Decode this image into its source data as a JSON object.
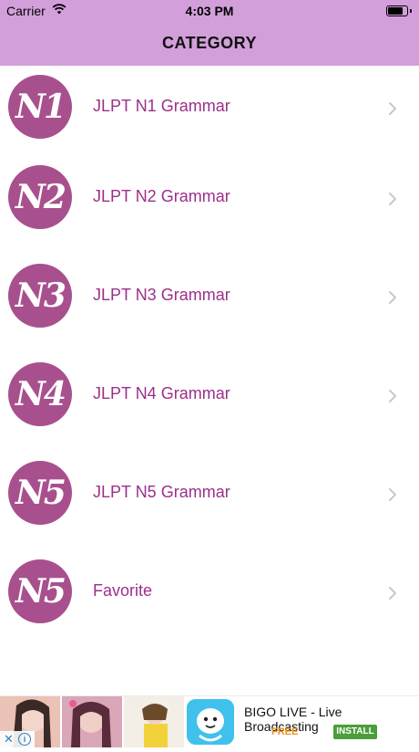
{
  "status_bar": {
    "carrier": "Carrier",
    "time": "4:03 PM",
    "wifi_icon": "wifi-icon",
    "battery_icon": "battery-icon"
  },
  "header": {
    "title": "CATEGORY",
    "background_color": "#d39fdb"
  },
  "categories": [
    {
      "badge": "N1",
      "label": "JLPT N1 Grammar"
    },
    {
      "badge": "N2",
      "label": "JLPT N2 Grammar"
    },
    {
      "badge": "N3",
      "label": "JLPT N3 Grammar"
    },
    {
      "badge": "N4",
      "label": "JLPT N4 Grammar"
    },
    {
      "badge": "N5",
      "label": "JLPT N5 Grammar"
    },
    {
      "badge": "N5",
      "label": "Favorite"
    }
  ],
  "colors": {
    "badge": "#a8508e",
    "label": "#9c2f8a",
    "chevron": "#c7c7cc"
  },
  "ad": {
    "app_name": "BIGO LIVE - Live Broadcasting",
    "price": "FREE",
    "install_label": "INSTALL",
    "close_icon": "close-icon",
    "info_icon": "info-icon",
    "install_color": "#4b9e3a",
    "price_color": "#e8941b"
  }
}
